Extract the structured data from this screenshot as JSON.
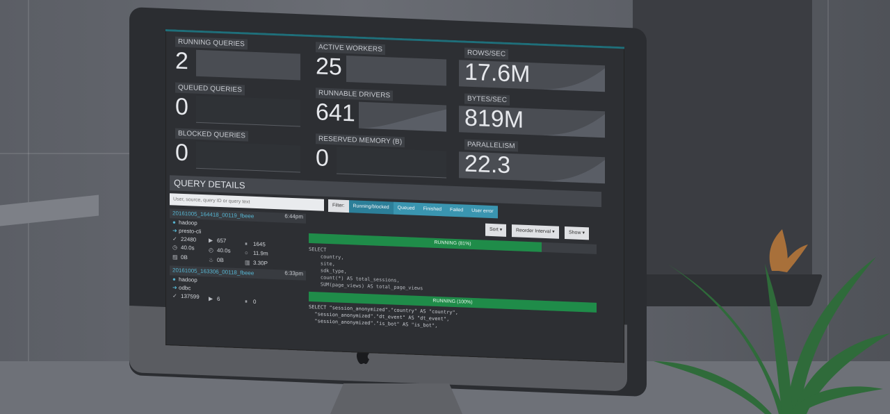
{
  "dashboard": {
    "tiles": [
      {
        "label": "RUNNING QUERIES",
        "value": "2"
      },
      {
        "label": "QUEUED QUERIES",
        "value": "0"
      },
      {
        "label": "BLOCKED QUERIES",
        "value": "0"
      },
      {
        "label": "ACTIVE WORKERS",
        "value": "25"
      },
      {
        "label": "RUNNABLE DRIVERS",
        "value": "641"
      },
      {
        "label": "RESERVED MEMORY (B)",
        "value": "0"
      },
      {
        "label": "ROWS/SEC",
        "value": "17.6M"
      },
      {
        "label": "BYTES/SEC",
        "value": "819M"
      },
      {
        "label": "PARALLELISM",
        "value": "22.3"
      }
    ]
  },
  "details": {
    "title": "QUERY DETAILS",
    "search_placeholder": "User, source, query ID or query text",
    "filter_label": "Filter:",
    "filters": [
      "Running/blocked",
      "Queued",
      "Finished",
      "Failed",
      "User error"
    ],
    "sort_label": "Sort ▾",
    "reorder_label": "Reorder Interval ▾",
    "show_label": "Show ▾"
  },
  "queries": [
    {
      "id": "20161005_164418_00119_fbeee",
      "time": "6:44pm",
      "user": "hadoop",
      "source": "presto-cli",
      "stats": [
        "22480",
        "657",
        "1645",
        "40.0s",
        "40.0s",
        "11.9m",
        "0B",
        "0B",
        "3.30P"
      ],
      "progress_label": "RUNNING (81%)",
      "progress": 81,
      "sql": "SELECT\n    country,\n    site,\n    sdk_type,\n    count(*) AS total_sessions,\n    SUM(page_views) AS total_page_views"
    },
    {
      "id": "20161005_163306_00118_fbeee",
      "time": "6:33pm",
      "user": "hadoop",
      "source": "odbc",
      "stats": [
        "137599",
        "6",
        "0"
      ],
      "progress_label": "RUNNING (100%)",
      "progress": 100,
      "sql": "SELECT \"session_anonymized\".\"country\" AS \"country\",\n  \"session_anonymized\".\"dt_event\" AS \"dt_event\",\n  \"session_anonymized\".\"is_bot\" AS \"is_bot\","
    }
  ],
  "colors": {
    "accent": "#3a95b0",
    "progress": "#1f8c49",
    "link": "#56b4d0"
  }
}
